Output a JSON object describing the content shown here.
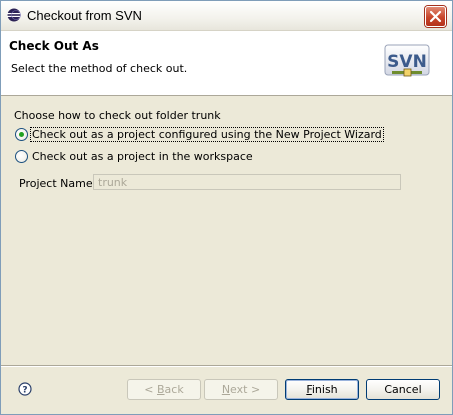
{
  "window": {
    "title": "Checkout from SVN"
  },
  "header": {
    "title": "Check Out As",
    "description": "Select the method of check out.",
    "logo_text": "SVN"
  },
  "content": {
    "group_label": "Choose how to check out folder trunk",
    "options": [
      {
        "label": "Check out as a project configured using the New Project Wizard",
        "checked": true
      },
      {
        "label": "Check out as a project in the workspace",
        "checked": false
      }
    ],
    "project_name": {
      "label": "Project Name:",
      "value": "trunk",
      "enabled": false
    }
  },
  "footer": {
    "back": {
      "prefix": "< ",
      "mnemonic": "B",
      "rest": "ack",
      "enabled": false
    },
    "next": {
      "mnemonic": "N",
      "rest": "ext >",
      "enabled": false
    },
    "finish": {
      "mnemonic": "F",
      "rest": "inish",
      "enabled": true
    },
    "cancel": {
      "label": "Cancel",
      "enabled": true
    }
  },
  "colors": {
    "dialog_bg": "#ece9d8",
    "header_bg": "#ffffff",
    "radio_dot": "#21a121",
    "close_button": "#c8452a"
  }
}
